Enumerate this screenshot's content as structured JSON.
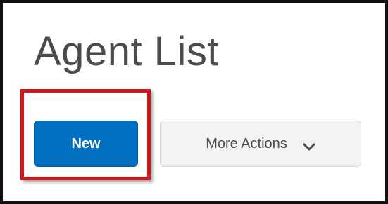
{
  "page": {
    "title": "Agent List"
  },
  "toolbar": {
    "new_label": "New",
    "more_actions_label": "More Actions"
  },
  "icons": {
    "more_actions": "chevron-down-icon"
  },
  "colors": {
    "primary_button": "#006fbf",
    "secondary_button": "#f1f3f5",
    "highlight": "#d2161e",
    "title_text": "#494c4e"
  }
}
